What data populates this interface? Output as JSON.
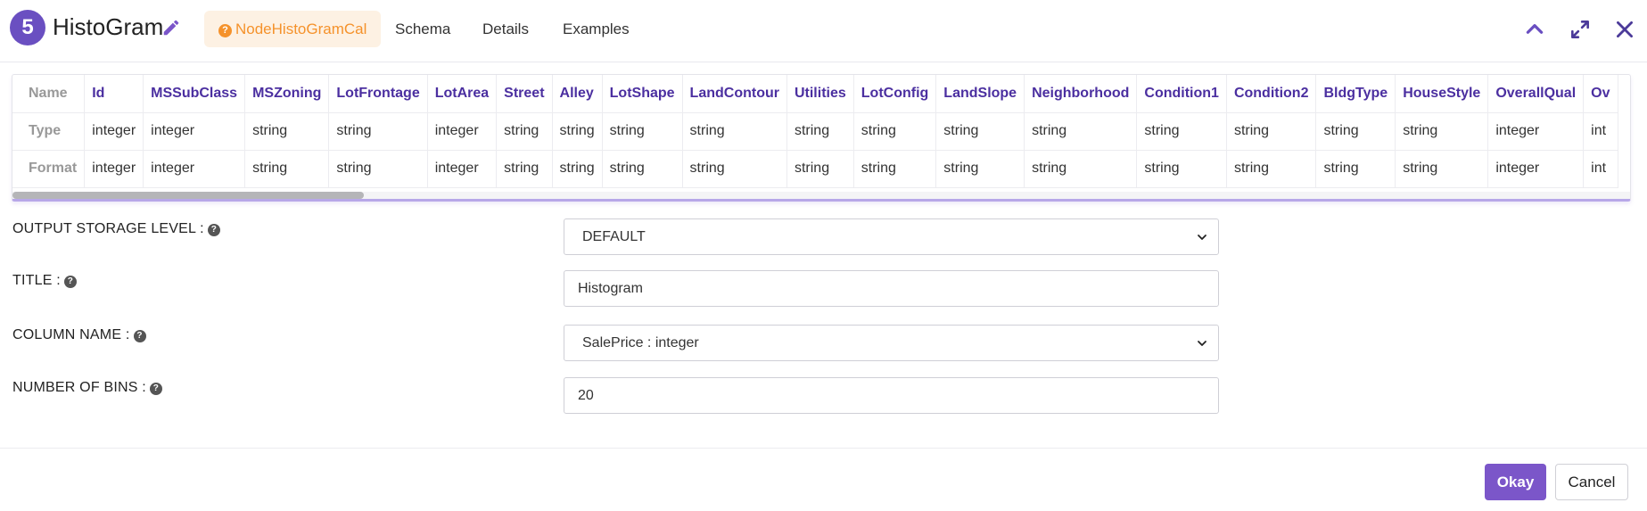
{
  "header": {
    "step_number": "5",
    "title": "HistoGram",
    "tabs": [
      {
        "label": "NodeHistoGramCal",
        "active": true
      },
      {
        "label": "Schema",
        "active": false
      },
      {
        "label": "Details",
        "active": false
      },
      {
        "label": "Examples",
        "active": false
      }
    ],
    "accent_color": "#6a4fc1",
    "active_tab_color": "#f5922b"
  },
  "schema_table": {
    "row_headers": [
      "Name",
      "Type",
      "Format"
    ],
    "columns": [
      {
        "name": "Id",
        "type": "integer",
        "format": "integer"
      },
      {
        "name": "MSSubClass",
        "type": "integer",
        "format": "integer"
      },
      {
        "name": "MSZoning",
        "type": "string",
        "format": "string"
      },
      {
        "name": "LotFrontage",
        "type": "string",
        "format": "string"
      },
      {
        "name": "LotArea",
        "type": "integer",
        "format": "integer"
      },
      {
        "name": "Street",
        "type": "string",
        "format": "string"
      },
      {
        "name": "Alley",
        "type": "string",
        "format": "string"
      },
      {
        "name": "LotShape",
        "type": "string",
        "format": "string"
      },
      {
        "name": "LandContour",
        "type": "string",
        "format": "string"
      },
      {
        "name": "Utilities",
        "type": "string",
        "format": "string"
      },
      {
        "name": "LotConfig",
        "type": "string",
        "format": "string"
      },
      {
        "name": "LandSlope",
        "type": "string",
        "format": "string"
      },
      {
        "name": "Neighborhood",
        "type": "string",
        "format": "string"
      },
      {
        "name": "Condition1",
        "type": "string",
        "format": "string"
      },
      {
        "name": "Condition2",
        "type": "string",
        "format": "string"
      },
      {
        "name": "BldgType",
        "type": "string",
        "format": "string"
      },
      {
        "name": "HouseStyle",
        "type": "string",
        "format": "string"
      },
      {
        "name": "OverallQual",
        "type": "integer",
        "format": "integer"
      },
      {
        "name": "Ov",
        "type": "int",
        "format": "int"
      }
    ]
  },
  "form": {
    "output_storage_level": {
      "label": "OUTPUT STORAGE LEVEL :",
      "value": "DEFAULT"
    },
    "title": {
      "label": "TITLE :",
      "value": "Histogram"
    },
    "column_name": {
      "label": "COLUMN NAME :",
      "value": "SalePrice : integer"
    },
    "number_of_bins": {
      "label": "NUMBER OF BINS :",
      "value": "20"
    }
  },
  "footer": {
    "okay_label": "Okay",
    "cancel_label": "Cancel"
  }
}
